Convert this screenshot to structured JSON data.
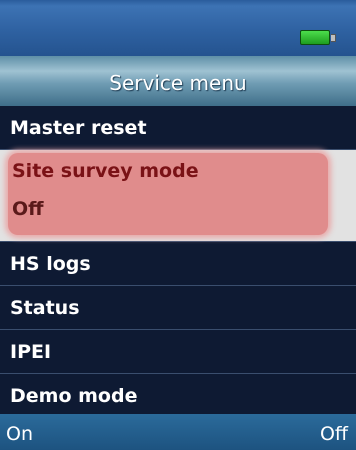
{
  "header": {
    "battery_icon": "battery-full-icon",
    "battery_color": "#35c435"
  },
  "title": "Service menu",
  "menu": {
    "items": [
      {
        "label": "Master reset"
      },
      {
        "label": "Site survey mode",
        "value": "Off",
        "selected": true
      },
      {
        "label": "HS logs"
      },
      {
        "label": "Status"
      },
      {
        "label": "IPEI"
      },
      {
        "label": "Demo mode"
      }
    ]
  },
  "softkeys": {
    "left": "On",
    "right": "Off"
  },
  "colors": {
    "background": "#0e1a33",
    "selection_highlight": "#e08c8c",
    "selected_text": "#7a1216"
  }
}
